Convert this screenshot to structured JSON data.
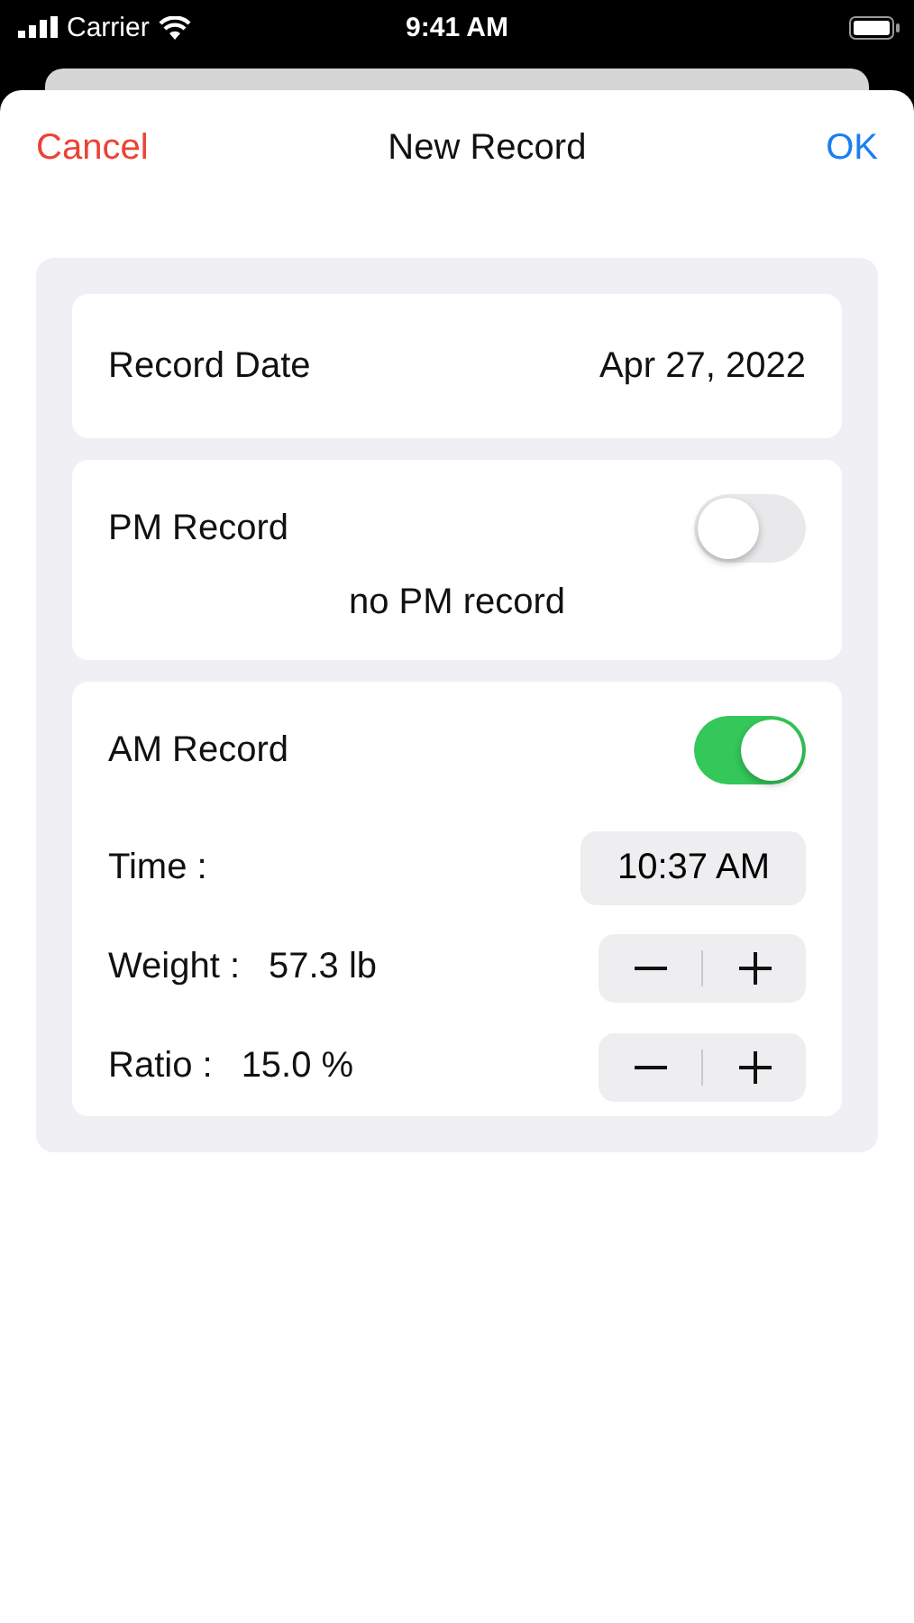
{
  "status_bar": {
    "carrier": "Carrier",
    "time": "9:41 AM"
  },
  "nav": {
    "cancel": "Cancel",
    "title": "New Record",
    "ok": "OK"
  },
  "date_card": {
    "label": "Record Date",
    "value": "Apr 27, 2022"
  },
  "pm": {
    "label": "PM Record",
    "on": false,
    "note": "no PM record"
  },
  "am": {
    "label": "AM Record",
    "on": true,
    "time_label": "Time :",
    "time": "10:37 AM",
    "rows": [
      {
        "label": "Weight :",
        "value": "57.3 lb"
      },
      {
        "label": "Ratio :",
        "value": "15.0 %"
      }
    ]
  }
}
